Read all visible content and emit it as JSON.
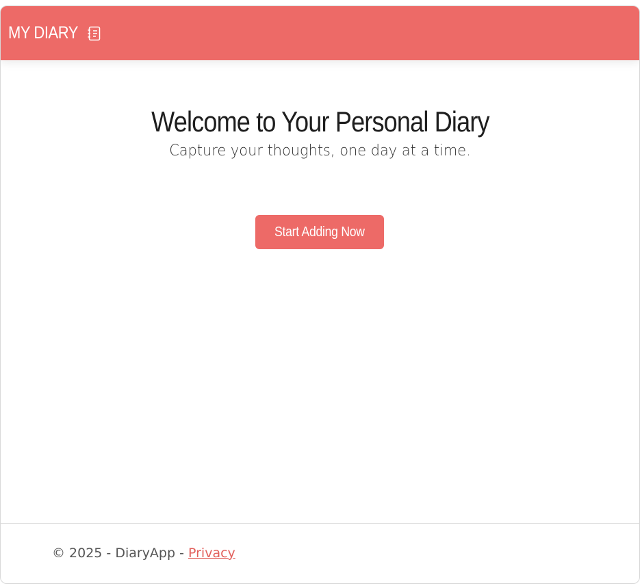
{
  "navbar": {
    "brand_label": "MY DIARY",
    "brand_icon": "journal-icon",
    "background_color": "#ed6a67"
  },
  "hero": {
    "title": "Welcome to Your Personal Diary",
    "subtitle": "Capture your thoughts, one day at a time."
  },
  "cta": {
    "label": "Start Adding Now",
    "color": "#ed6a67"
  },
  "footer": {
    "prefix": "© 2025 - DiaryApp - ",
    "privacy_label": "Privacy",
    "link_color": "#e2605c"
  }
}
